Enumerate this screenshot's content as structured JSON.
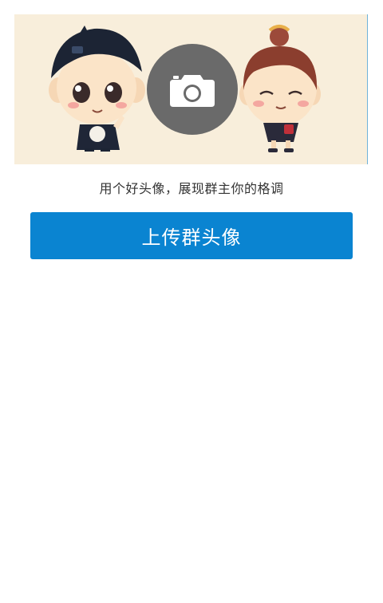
{
  "cover": {
    "illustration": "cartoon-couple-illustration",
    "camera_icon": "camera-icon",
    "background_color": "#f8eedb"
  },
  "hint_text": "用个好头像，展现群主你的格调",
  "upload_button": {
    "label": "上传群头像",
    "color": "#0a84d1"
  }
}
